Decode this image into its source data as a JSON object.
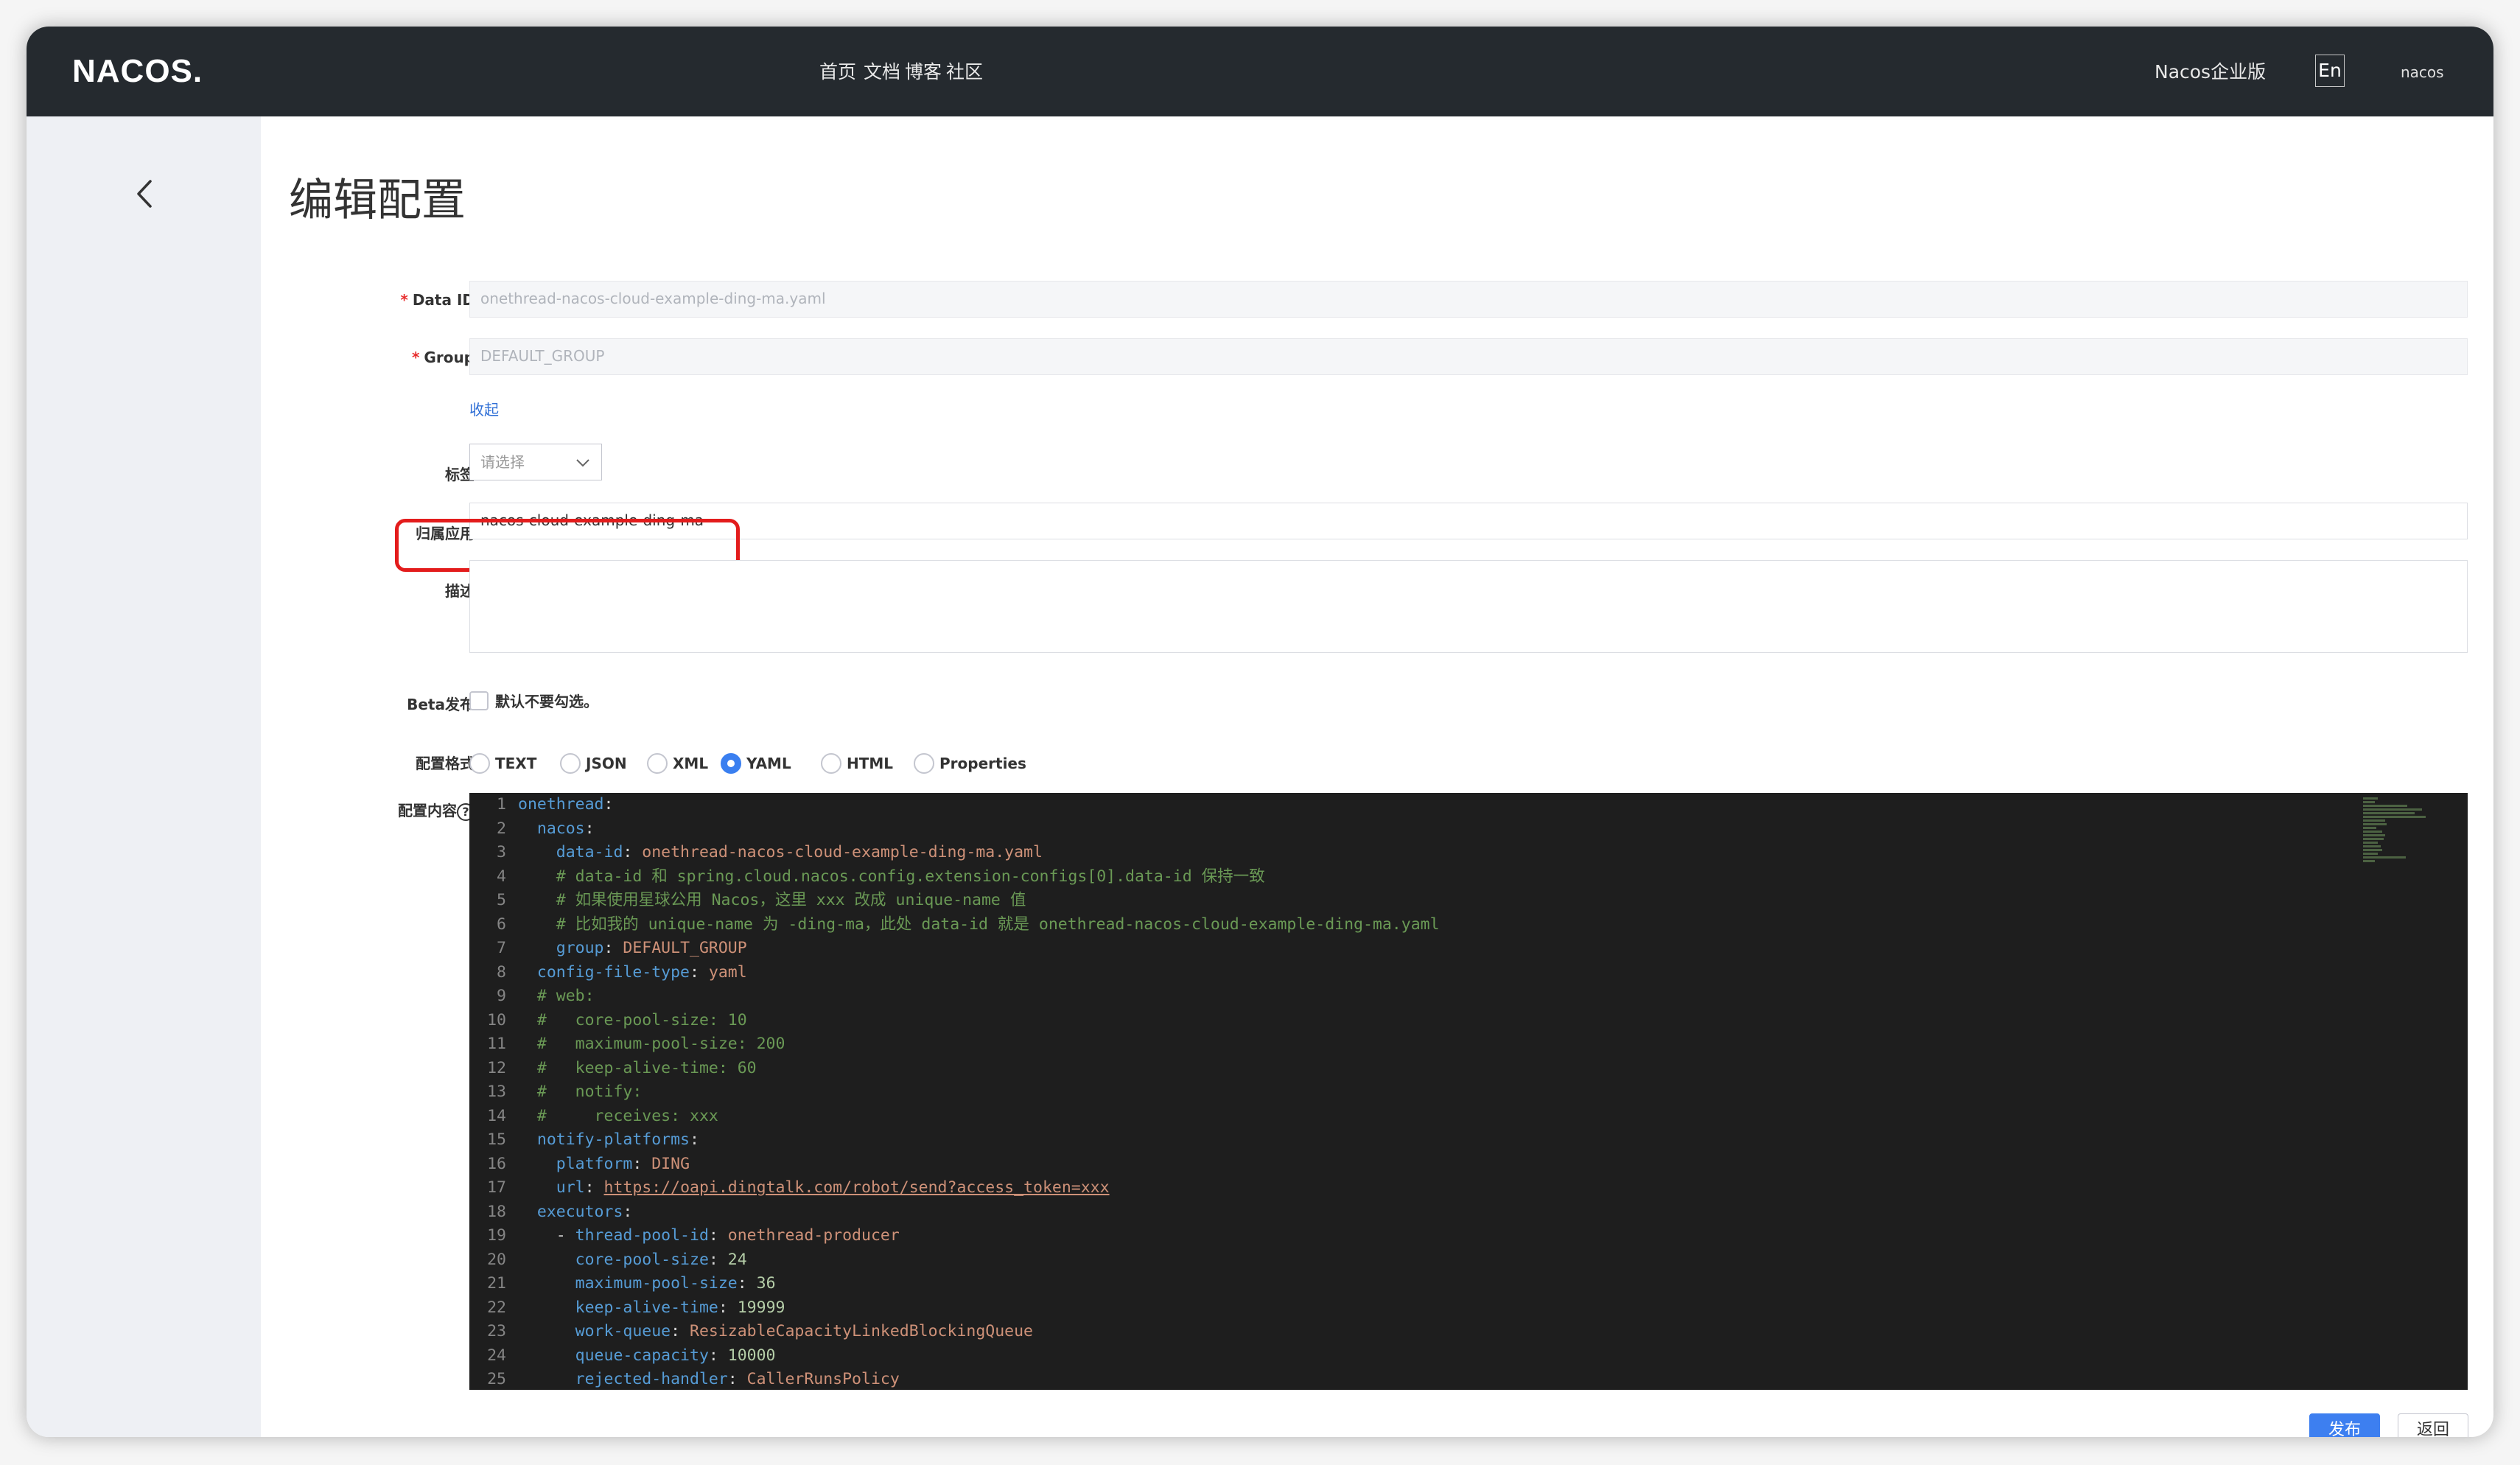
{
  "nav": {
    "logo": "NACOS.",
    "items": [
      "首页",
      "文档",
      "博客",
      "社区",
      "Nacos企业版"
    ],
    "lang": "En",
    "user": "nacos"
  },
  "page": {
    "title": "编辑配置"
  },
  "form": {
    "data_id": {
      "label": "Data ID:",
      "value": "onethread-nacos-cloud-example-ding-ma.yaml"
    },
    "group": {
      "label": "Group:",
      "value": "DEFAULT_GROUP"
    },
    "collapse_link": "收起",
    "tags": {
      "label": "标签:",
      "placeholder": "请选择"
    },
    "app": {
      "label": "归属应用:",
      "value": "nacos-cloud-example-ding-ma"
    },
    "desc": {
      "label": "描述:",
      "value": ""
    },
    "beta": {
      "label": "Beta发布:",
      "text": "默认不要勾选。"
    },
    "format": {
      "label": "配置格式:",
      "options": [
        "TEXT",
        "JSON",
        "XML",
        "YAML",
        "HTML",
        "Properties"
      ],
      "selected": "YAML"
    },
    "content": {
      "label": "配置内容"
    }
  },
  "editor": {
    "line_numbers": [
      "1",
      "2",
      "3",
      "4",
      "5",
      "6",
      "7",
      "8",
      "9",
      "10",
      "11",
      "12",
      "13",
      "14",
      "15",
      "16",
      "17",
      "18",
      "19",
      "20",
      "21",
      "22",
      "23",
      "24",
      "25"
    ],
    "lines": [
      "onethread:",
      "  nacos:",
      "    data-id: onethread-nacos-cloud-example-ding-ma.yaml",
      "    # data-id 和 spring.cloud.nacos.config.extension-configs[0].data-id 保持一致",
      "    # 如果使用星球公用 Nacos，这里 xxx 改成 unique-name 值",
      "    # 比如我的 unique-name 为 -ding-ma，此处 data-id 就是 onethread-nacos-cloud-example-ding-ma.yaml",
      "    group: DEFAULT_GROUP",
      "  config-file-type: yaml",
      "  # web:",
      "  #   core-pool-size: 10",
      "  #   maximum-pool-size: 200",
      "  #   keep-alive-time: 60",
      "  #   notify:",
      "  #     receives: xxx",
      "  notify-platforms:",
      "    platform: DING",
      "    url: https://oapi.dingtalk.com/robot/send?access_token=xxx",
      "  executors:",
      "    - thread-pool-id: onethread-producer",
      "      core-pool-size: 24",
      "      maximum-pool-size: 36",
      "      keep-alive-time: 19999",
      "      work-queue: ResizableCapacityLinkedBlockingQueue",
      "      queue-capacity: 10000",
      "      rejected-handler: CallerRunsPolicy"
    ]
  },
  "buttons": {
    "publish": "发布",
    "back": "返回"
  },
  "colors": {
    "nav_bg": "#252a2f",
    "primary": "#3d7ff0",
    "highlight": "#e31c1c",
    "editor_bg": "#1e1e1e"
  },
  "icons": {
    "back": "chevron-left-icon",
    "select": "chevron-down-icon",
    "help": "help-circle-icon"
  }
}
